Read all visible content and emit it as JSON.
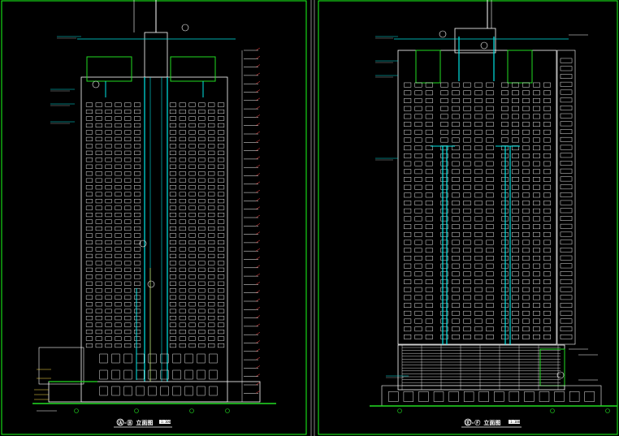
{
  "colors": {
    "background": "#000000",
    "frame": "#1aff1a",
    "facade": "#ffffff",
    "structure": "#00e5e5",
    "accent_green": "#22dd22",
    "dimension": "#ff4444",
    "marker": "#ffe04a"
  },
  "left_view": {
    "title": "Ⓐ-Ⓑ 立面图",
    "scale_bar": "1:100"
  },
  "right_view": {
    "title": "Ⓔ-Ⓕ 立面图",
    "scale_bar": "1:100"
  }
}
